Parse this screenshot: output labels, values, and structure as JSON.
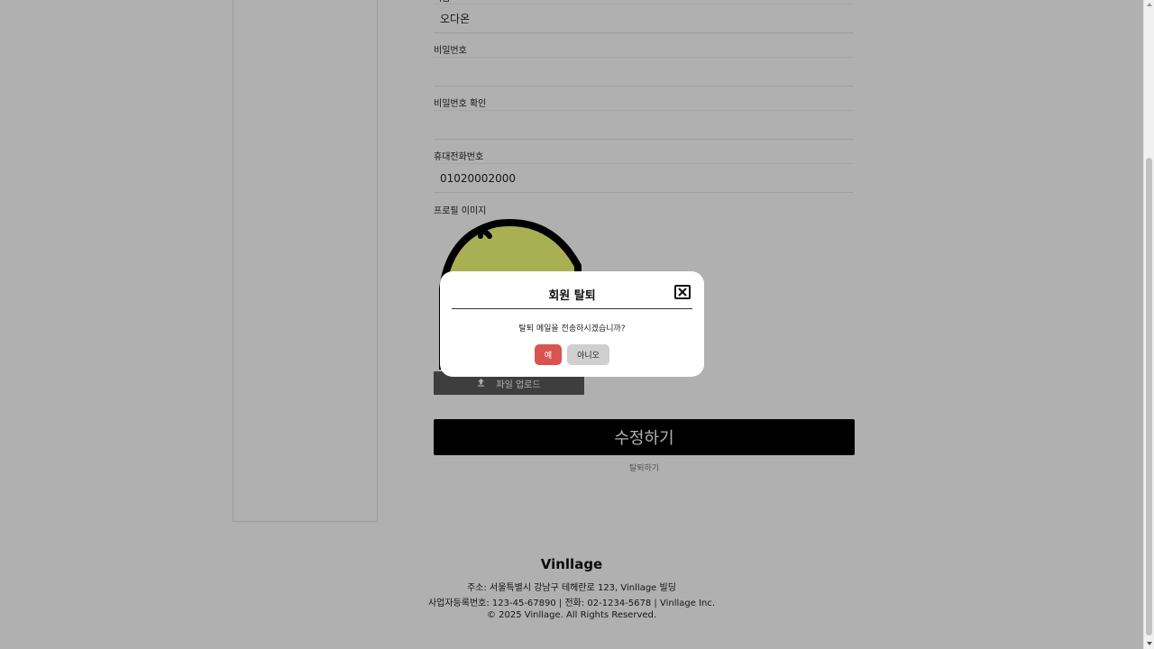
{
  "form": {
    "name_label": "이름",
    "name_value": "오다온",
    "password_label": "비밀번호",
    "password_value": "",
    "password_confirm_label": "비밀번호 확인",
    "password_confirm_value": "",
    "phone_label": "휴대전화번호",
    "phone_value": "01020002000",
    "profile_label": "프로필 이미지",
    "upload_label": "파일 업로드",
    "upload_icon": "upload-icon",
    "submit_label": "수정하기",
    "withdraw_label": "탈퇴하기"
  },
  "footer": {
    "brand": "Vinllage",
    "address": "주소: 서울특별시 강남구 테헤란로 123, Vinllage 빌딩",
    "business": "사업자등록번호: 123-45-67890 | 전화: 02-1234-5678 | Vinllage Inc.",
    "copyright": "© 2025 Vinllage. All Rights Reserved."
  },
  "modal": {
    "title": "회원 탈퇴",
    "close_icon": "close-icon",
    "message": "탈퇴 메일을 전송하시겠습니까?",
    "yes_label": "예",
    "no_label": "아니오",
    "yes_color": "#d9534f"
  },
  "colors": {
    "overlay": "rgba(0,0,0,0.31)",
    "submit_bg": "#000000",
    "upload_bg": "#5a5a5a",
    "avatar_fill": "#f5ff7a"
  }
}
